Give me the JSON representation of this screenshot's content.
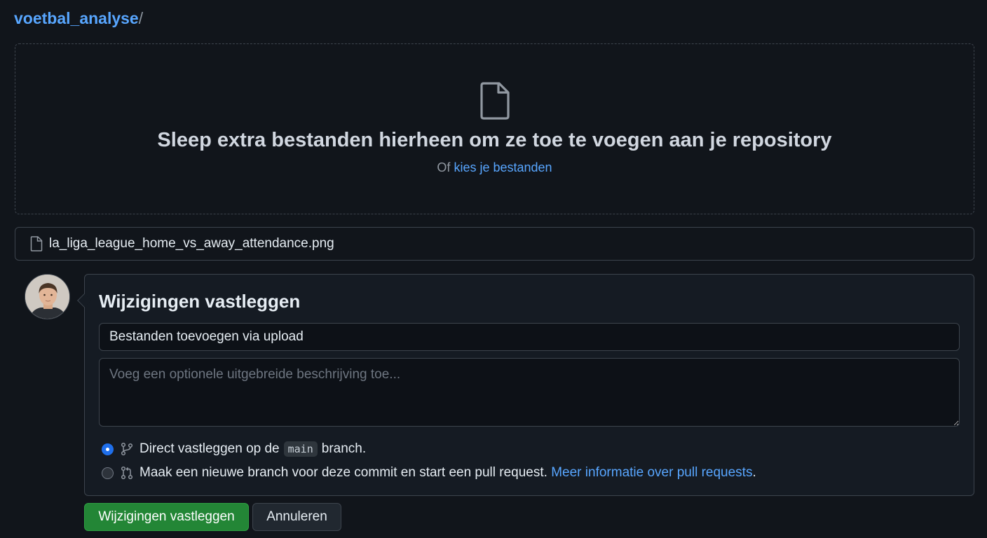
{
  "breadcrumb": {
    "repo": "voetbal_analyse",
    "separator": "/"
  },
  "dropzone": {
    "title": "Sleep extra bestanden hierheen om ze toe te voegen aan je repository",
    "prefix": "Of",
    "choose_link": "kies je bestanden"
  },
  "uploaded_file": {
    "name": "la_liga_league_home_vs_away_attendance.png"
  },
  "commit": {
    "heading": "Wijzigingen vastleggen",
    "summary_value": "Bestanden toevoegen via upload",
    "description_placeholder": "Voeg een optionele uitgebreide beschrijving toe...",
    "option_direct": {
      "before": "Direct vastleggen op de",
      "branch": "main",
      "after": "branch.",
      "selected": true
    },
    "option_new_branch": {
      "text": "Maak een nieuwe branch voor deze commit en start een pull request.",
      "link": "Meer informatie over pull requests",
      "after": ".",
      "selected": false
    }
  },
  "buttons": {
    "commit": "Wijzigingen vastleggen",
    "cancel": "Annuleren"
  },
  "icons": {
    "file": "file-icon",
    "branch": "git-branch-icon",
    "pull_request": "git-pull-request-icon",
    "avatar": "user-avatar"
  },
  "colors": {
    "accent": "#58a6ff",
    "primary_button": "#238636",
    "background": "#11151b"
  }
}
